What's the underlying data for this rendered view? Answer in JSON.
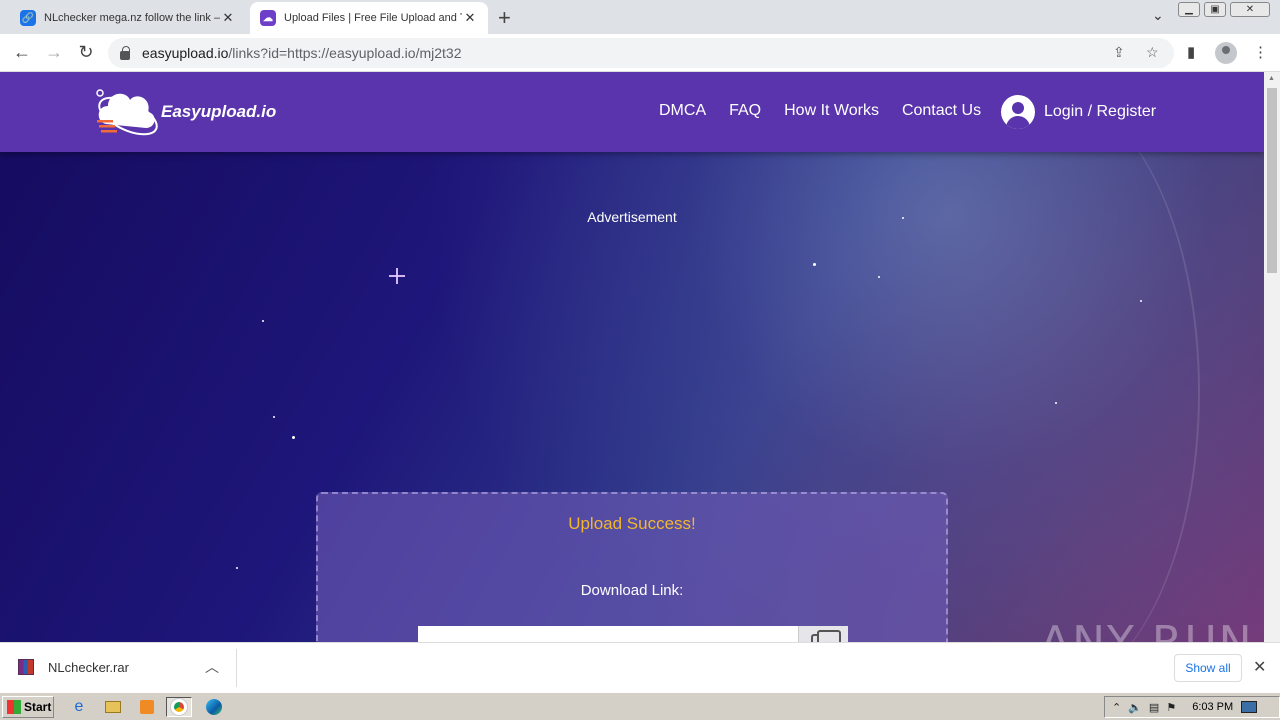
{
  "browser": {
    "tabs": [
      {
        "title": "NLchecker mega.nz follow the link —",
        "active": false,
        "favicon": "link-icon",
        "color": "#1a73e8"
      },
      {
        "title": "Upload Files | Free File Upload and T",
        "active": true,
        "favicon": "easyupload-icon",
        "color": "#6d3fc9"
      }
    ],
    "new_tab": "+",
    "tab_search": "⌄",
    "window_controls": {
      "minimize": "▁",
      "restore": "▣",
      "close": "✕"
    },
    "nav": {
      "back": "←",
      "forward": "→",
      "reload": "↻"
    },
    "url_host": "easyupload.io",
    "url_rest": "/links?id=https://easyupload.io/mj2t32",
    "toolbar_icons": {
      "share": "⇪",
      "star": "☆",
      "sidepanel": "▮",
      "menu": "⋮"
    }
  },
  "site": {
    "logo_text": "Easyupload.io",
    "nav": [
      "DMCA",
      "FAQ",
      "How It Works",
      "Contact Us"
    ],
    "login": "Login / Register",
    "advertisement": "Advertisement",
    "card": {
      "success": "Upload Success!",
      "download_label": "Download Link:",
      "download_value": ""
    },
    "accent": "#f2b630",
    "header_color": "#5a34ac"
  },
  "watermark": "ANY RUN",
  "downloads": {
    "file": "NLchecker.rar",
    "show_all": "Show all",
    "close": "✕"
  },
  "taskbar": {
    "start": "Start",
    "clock": "6:03 PM"
  }
}
